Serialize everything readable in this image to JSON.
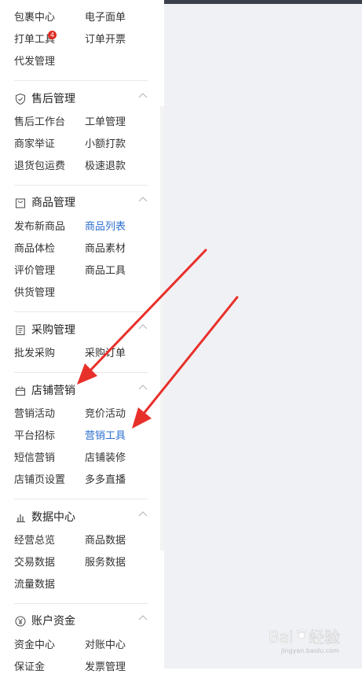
{
  "top_items": {
    "row1": [
      "包裹中心",
      "电子面单"
    ],
    "row2": [
      "打单工具",
      "订单开票"
    ],
    "row3": [
      "代发管理"
    ],
    "badge": "4"
  },
  "groups": [
    {
      "title": "售后管理",
      "icon": "shield-check-icon",
      "items": [
        "售后工作台",
        "工单管理",
        "商家举证",
        "小额打款",
        "退货包运费",
        "极速退款"
      ]
    },
    {
      "title": "商品管理",
      "icon": "bag-icon",
      "items": [
        "发布新商品",
        "商品列表",
        "商品体检",
        "商品素材",
        "评价管理",
        "商品工具",
        "供货管理"
      ],
      "active": "商品列表"
    },
    {
      "title": "采购管理",
      "icon": "document-icon",
      "items": [
        "批发采购",
        "采购订单"
      ]
    },
    {
      "title": "店铺营销",
      "icon": "gift-box-icon",
      "items": [
        "营销活动",
        "竞价活动",
        "平台招标",
        "营销工具",
        "短信营销",
        "店铺装修",
        "店铺页设置",
        "多多直播"
      ],
      "active": "营销工具"
    },
    {
      "title": "数据中心",
      "icon": "bar-chart-icon",
      "items": [
        "经营总览",
        "商品数据",
        "交易数据",
        "服务数据",
        "流量数据"
      ]
    },
    {
      "title": "账户资金",
      "icon": "yen-icon",
      "items": [
        "资金中心",
        "对账中心",
        "保证金",
        "发票管理"
      ]
    }
  ],
  "colors": {
    "active_link": "#2c6fd1",
    "arrow": "#e8302a",
    "badge": "#e02e24"
  },
  "watermark": {
    "brand": "Bai",
    "brand2": "经验",
    "sub": "jingyan.baidu.com"
  }
}
